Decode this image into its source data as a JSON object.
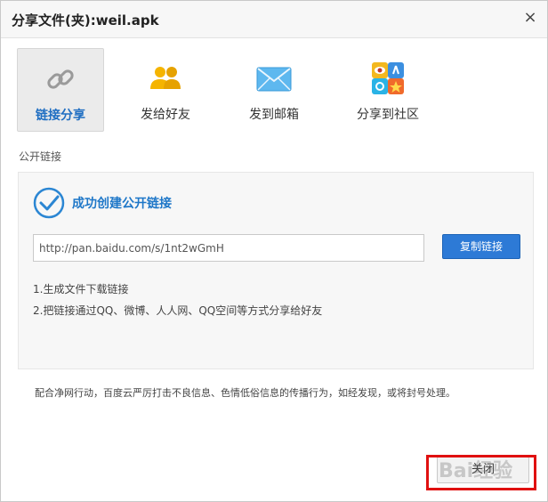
{
  "dialog": {
    "title": "分享文件(夹):weil.apk",
    "close_glyph": "×"
  },
  "tabs": [
    {
      "label": "链接分享",
      "icon": "link-icon",
      "active": true
    },
    {
      "label": "发给好友",
      "icon": "friends-icon",
      "active": false
    },
    {
      "label": "发到邮箱",
      "icon": "mail-icon",
      "active": false
    },
    {
      "label": "分享到社区",
      "icon": "community-icon",
      "active": false
    }
  ],
  "section": {
    "label": "公开链接"
  },
  "panel": {
    "success_text": "成功创建公开链接",
    "link_value": "http://pan.baidu.com/s/1nt2wGmH",
    "copy_button": "复制链接",
    "tips": [
      "1.生成文件下载链接",
      "2.把链接通过QQ、微博、人人网、QQ空间等方式分享给好友"
    ]
  },
  "notice": "配合净网行动，百度云严厉打击不良信息、色情低俗信息的传播行为，如经发现，或将封号处理。",
  "footer": {
    "close_button": "关闭"
  },
  "watermark": "Bai经验",
  "colors": {
    "accent": "#1e77c8",
    "button": "#2d7ad6",
    "highlight": "#e01010"
  }
}
